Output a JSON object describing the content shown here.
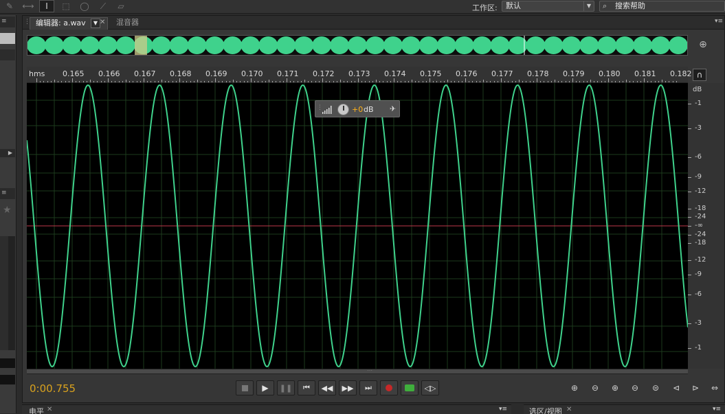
{
  "toolbar": {
    "tools": [
      "spot-heal-icon",
      "time-selection-icon",
      "text-cursor-icon",
      "marquee-icon",
      "lasso-icon",
      "brush-icon",
      "eraser-icon"
    ]
  },
  "workspace": {
    "label": "工作区:",
    "value": "默认"
  },
  "search": {
    "placeholder": "搜索帮助"
  },
  "tabs": [
    {
      "label": "编辑器: a.wav",
      "active": true
    },
    {
      "label": "混音器",
      "active": false
    }
  ],
  "ruler": {
    "unit": "hms",
    "ticks": [
      "0.165",
      "0.166",
      "0.167",
      "0.168",
      "0.169",
      "0.170",
      "0.171",
      "0.172",
      "0.173",
      "0.174",
      "0.175",
      "0.176",
      "0.177",
      "0.178",
      "0.179",
      "0.180",
      "0.181",
      "0.182"
    ]
  },
  "db_scale": {
    "unit": "dB",
    "labels": [
      "-1",
      "-3",
      "-6",
      "-9",
      "-12",
      "-18",
      "-24",
      "-∞",
      "-24",
      "-18",
      "-12",
      "-9",
      "-6",
      "-3",
      "-1"
    ]
  },
  "hud": {
    "value": "+0",
    "unit": "dB"
  },
  "waveform": {
    "color": "#3fd28c",
    "cycles": 9.3,
    "background": "#000000"
  },
  "transport": {
    "time": "0:00.755",
    "buttons": [
      "stop",
      "play",
      "pause",
      "go-to-start",
      "rewind",
      "fast-forward",
      "go-to-end",
      "record",
      "loop",
      "skip"
    ]
  },
  "bottom": {
    "left_tab": "电平",
    "right_tab": "选区/视图"
  },
  "colors": {
    "accent": "#d9a21e",
    "wave": "#3fd28c",
    "center_line": "#c0394a"
  }
}
